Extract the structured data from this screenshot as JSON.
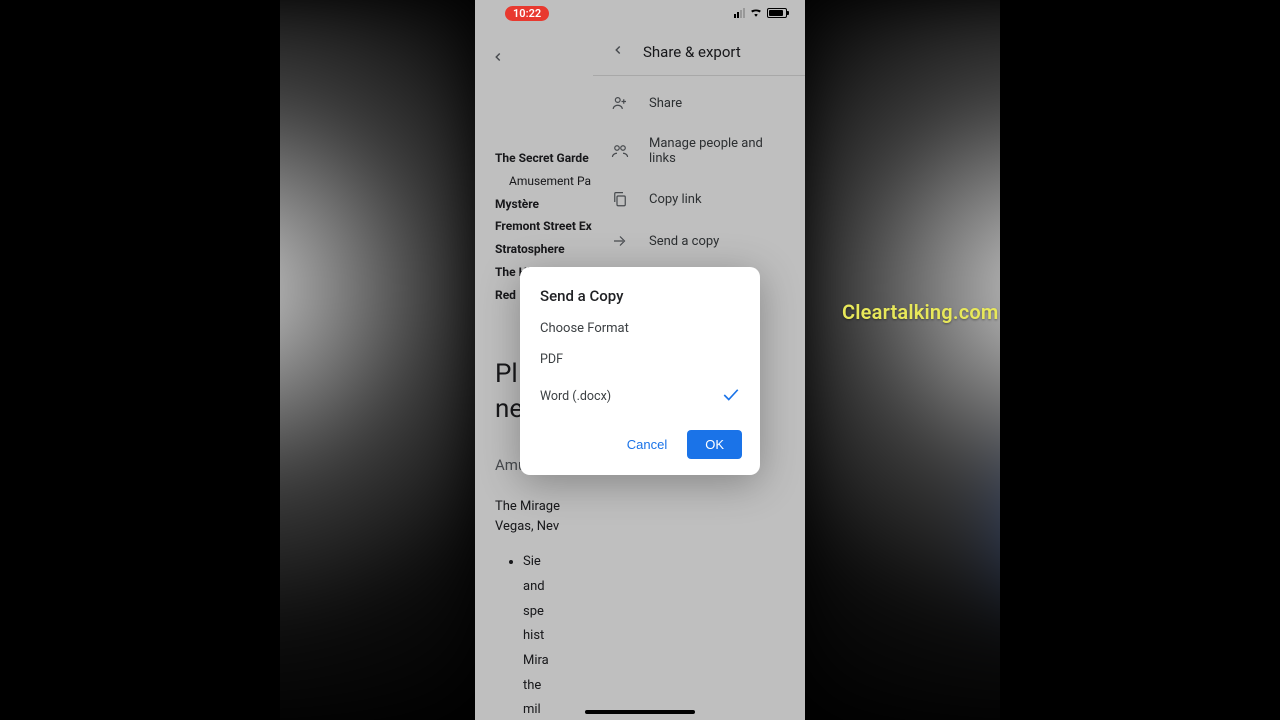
{
  "status": {
    "time": "10:22"
  },
  "doc": {
    "items": [
      "The Secret Garde",
      "Amusement Pa",
      "Mystère",
      "Fremont Street Ex",
      "Stratosphere",
      "The High Roller at",
      "Red "
    ],
    "heading_l1": "Pl",
    "heading_l2": "ne",
    "sub": "Amusem",
    "para_l1": "The Mirage",
    "para_l2": "Vegas, Nev",
    "bullets": [
      "Sie",
      "and",
      "spe",
      "hist",
      "Mira",
      "the",
      "mil"
    ]
  },
  "share": {
    "title": "Share & export",
    "rows": [
      {
        "label": "Share"
      },
      {
        "label": "Manage people and links"
      },
      {
        "label": "Copy link"
      },
      {
        "label": "Send a copy"
      }
    ]
  },
  "modal": {
    "title": "Send a Copy",
    "subtitle": "Choose Format",
    "formats": [
      {
        "label": "PDF",
        "selected": false
      },
      {
        "label": "Word (.docx)",
        "selected": true
      }
    ],
    "cancel": "Cancel",
    "ok": "OK"
  },
  "watermark": "Cleartalking.com"
}
